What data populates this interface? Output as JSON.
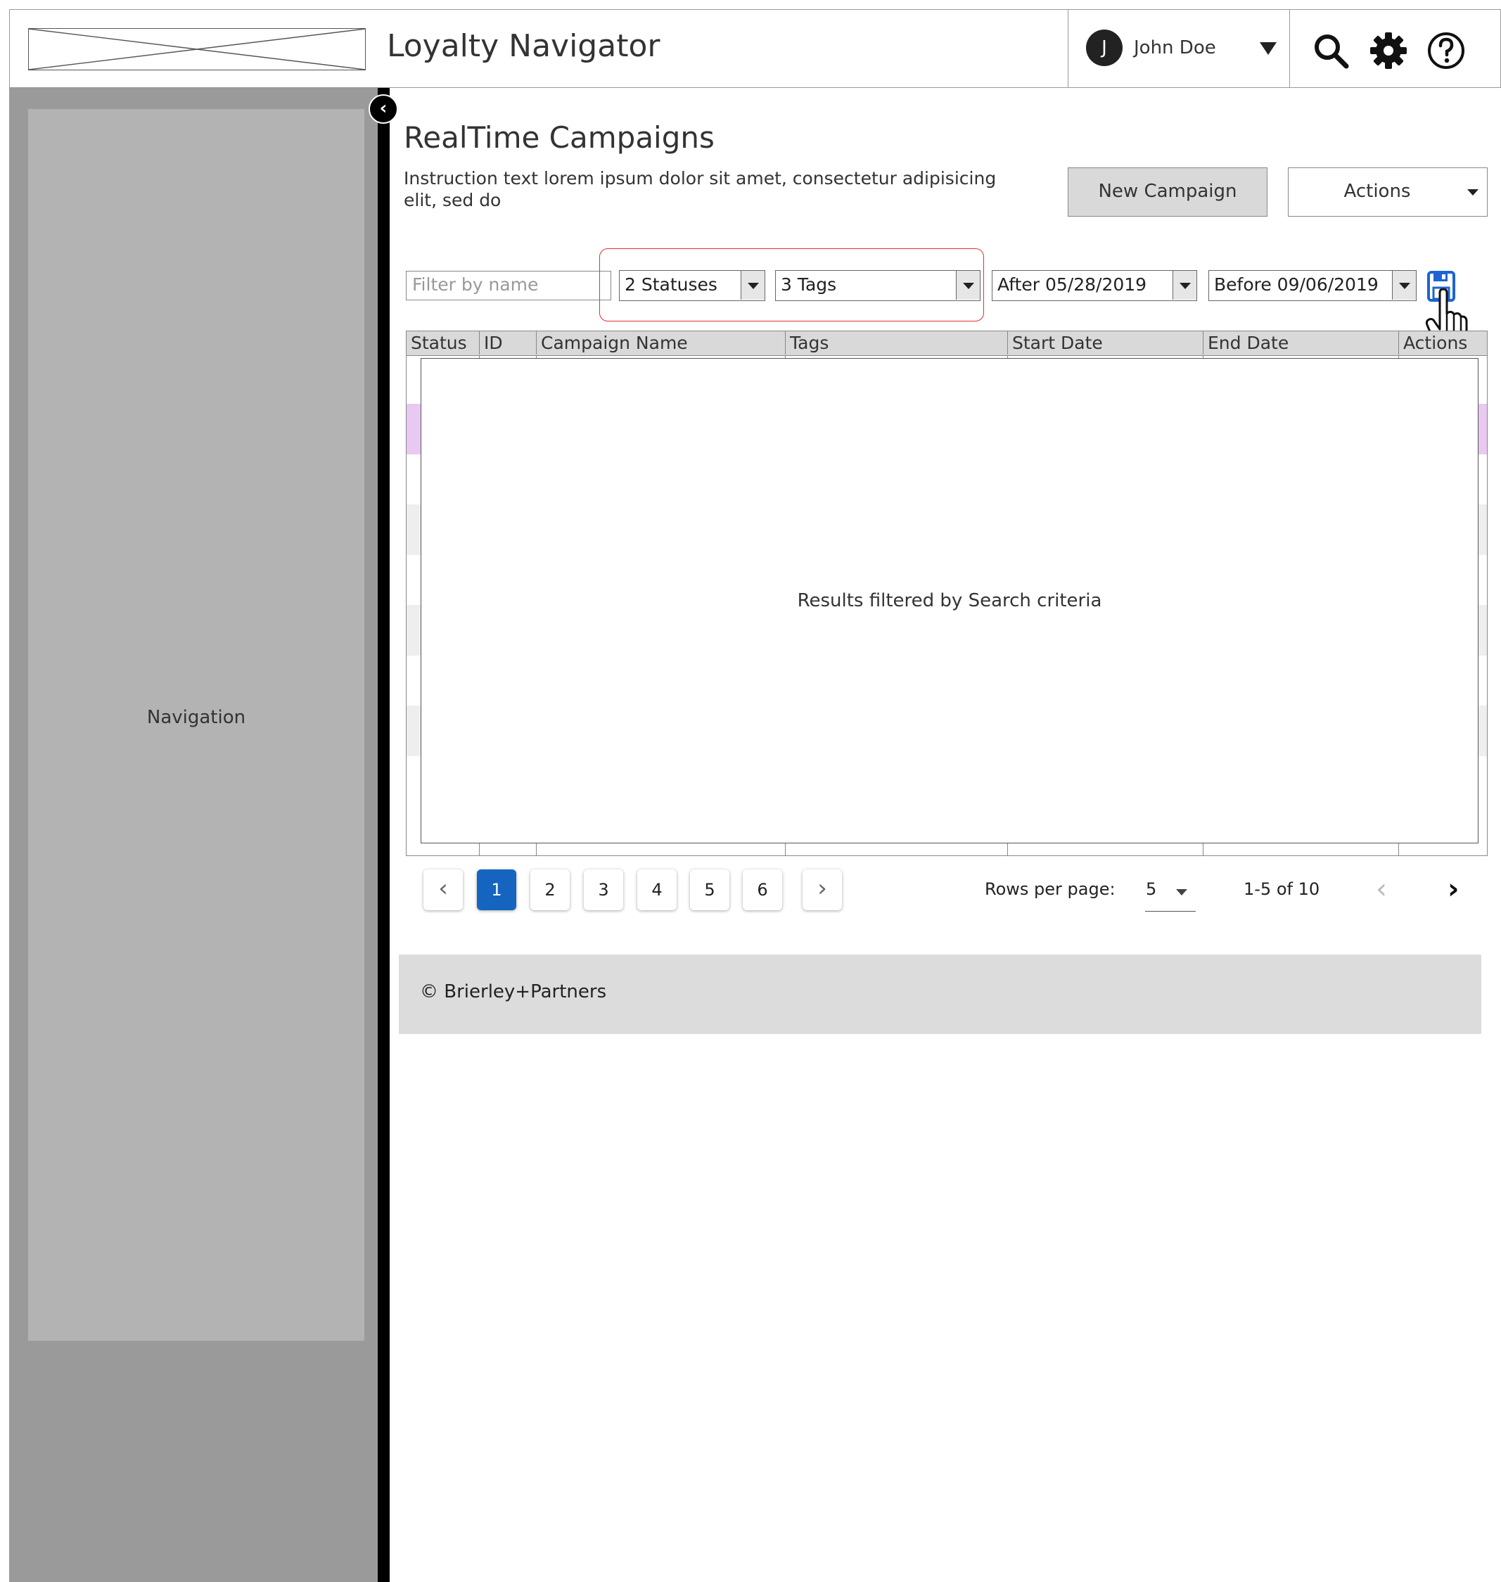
{
  "header": {
    "app_title": "Loyalty Navigator",
    "user": {
      "initial": "J",
      "name": "John Doe"
    },
    "icons": [
      "search-icon",
      "gear-icon",
      "help-icon"
    ]
  },
  "sidebar": {
    "label": "Navigation",
    "collapse_icon": "chevron-left-icon"
  },
  "page": {
    "title": "RealTime Campaigns",
    "instruction": "Instruction text lorem ipsum dolor sit amet, consectetur adipisicing elit, sed do",
    "new_campaign_label": "New Campaign",
    "actions_label": "Actions"
  },
  "filters": {
    "name_placeholder": "Filter by name",
    "statuses": "2 Statuses",
    "tags": "3 Tags",
    "after": "After 05/28/2019",
    "before": "Before 09/06/2019",
    "save_icon": "save-icon",
    "highlight_color": "#e03030"
  },
  "table": {
    "columns": [
      "Status",
      "ID",
      "Campaign Name",
      "Tags",
      "Start Date",
      "End Date",
      "Actions"
    ],
    "overlay_text": "Results filtered by Search criteria",
    "selected_row_color": "#e7c9f2"
  },
  "pagination": {
    "pages": [
      "1",
      "2",
      "3",
      "4",
      "5",
      "6"
    ],
    "current_page": "1",
    "prev_glyph": "‹",
    "next_glyph": "›",
    "rows_per_page_label": "Rows per page:",
    "rows_per_page": "5",
    "range": "1-5 of 10",
    "accent_color": "#1565c0"
  },
  "footer": {
    "text": "© Brierley+Partners"
  }
}
